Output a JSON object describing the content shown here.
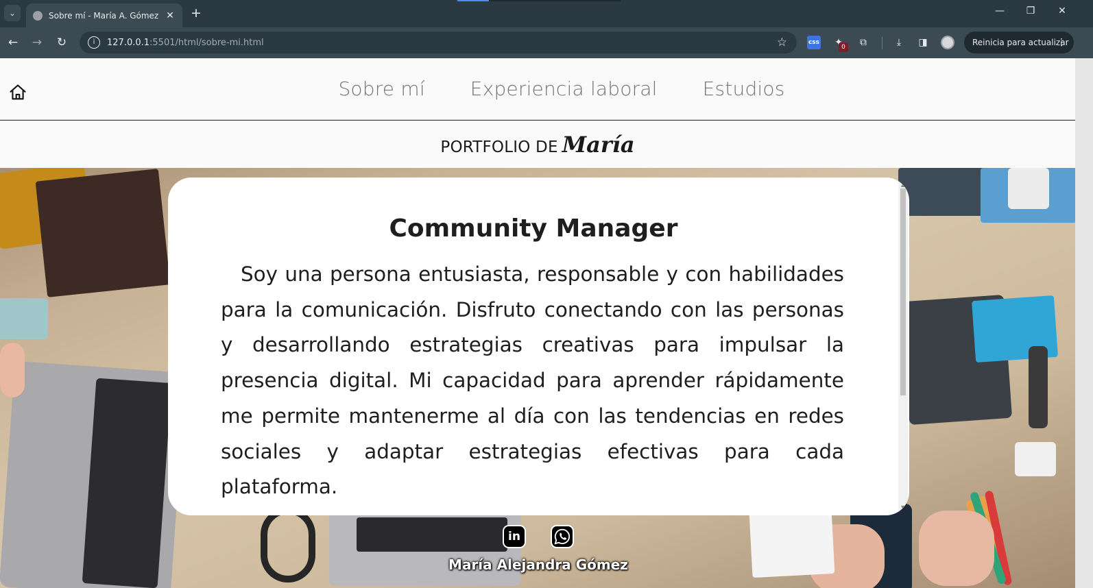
{
  "browser": {
    "tab_title": "Sobre mí - María A. Gómez",
    "url_host": "127.0.0.1",
    "url_rest": ":5501/html/sobre-mi.html",
    "update_button": "Reinicia para actualizar",
    "extension_badge": "0"
  },
  "nav": {
    "items": [
      {
        "label": "Sobre mí"
      },
      {
        "label": "Experiencia laboral"
      },
      {
        "label": "Estudios"
      }
    ]
  },
  "brand": {
    "prefix": "PORTFOLIO DE",
    "name": "María"
  },
  "card": {
    "title": "Community Manager",
    "text": "Soy una persona entusiasta, responsable y con habilidades para la comunicación. Disfruto conectando con las personas y desarrollando estrategias creativas para impulsar la presencia digital. Mi capacidad para aprender rápidamente me permite mantenerme al día con las tendencias en redes sociales y adaptar estrategias efectivas para cada plataforma."
  },
  "footer": {
    "linkedin_label": "in",
    "name": "María Alejandra Gómez"
  },
  "colors": {
    "chrome_dark": "#2b3a42",
    "chrome_toolbar": "#3c4b53",
    "nav_text": "#737373",
    "card_bg": "#ffffff",
    "card_text": "#1e1e1e"
  }
}
